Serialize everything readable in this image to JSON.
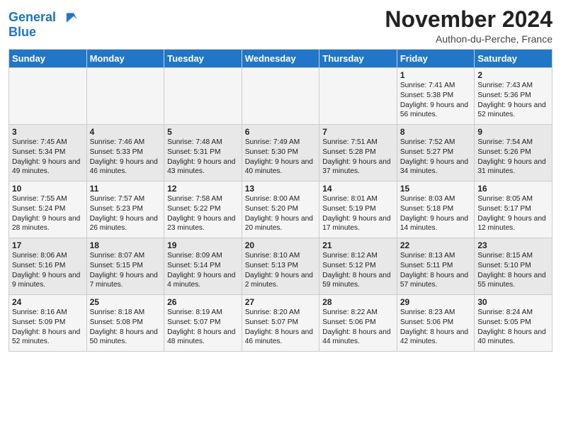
{
  "logo": {
    "line1": "General",
    "line2": "Blue"
  },
  "title": "November 2024",
  "location": "Authon-du-Perche, France",
  "days_of_week": [
    "Sunday",
    "Monday",
    "Tuesday",
    "Wednesday",
    "Thursday",
    "Friday",
    "Saturday"
  ],
  "weeks": [
    [
      {
        "day": "",
        "sunrise": "",
        "sunset": "",
        "daylight": ""
      },
      {
        "day": "",
        "sunrise": "",
        "sunset": "",
        "daylight": ""
      },
      {
        "day": "",
        "sunrise": "",
        "sunset": "",
        "daylight": ""
      },
      {
        "day": "",
        "sunrise": "",
        "sunset": "",
        "daylight": ""
      },
      {
        "day": "",
        "sunrise": "",
        "sunset": "",
        "daylight": ""
      },
      {
        "day": "1",
        "sunrise": "Sunrise: 7:41 AM",
        "sunset": "Sunset: 5:38 PM",
        "daylight": "Daylight: 9 hours and 56 minutes."
      },
      {
        "day": "2",
        "sunrise": "Sunrise: 7:43 AM",
        "sunset": "Sunset: 5:36 PM",
        "daylight": "Daylight: 9 hours and 52 minutes."
      }
    ],
    [
      {
        "day": "3",
        "sunrise": "Sunrise: 7:45 AM",
        "sunset": "Sunset: 5:34 PM",
        "daylight": "Daylight: 9 hours and 49 minutes."
      },
      {
        "day": "4",
        "sunrise": "Sunrise: 7:46 AM",
        "sunset": "Sunset: 5:33 PM",
        "daylight": "Daylight: 9 hours and 46 minutes."
      },
      {
        "day": "5",
        "sunrise": "Sunrise: 7:48 AM",
        "sunset": "Sunset: 5:31 PM",
        "daylight": "Daylight: 9 hours and 43 minutes."
      },
      {
        "day": "6",
        "sunrise": "Sunrise: 7:49 AM",
        "sunset": "Sunset: 5:30 PM",
        "daylight": "Daylight: 9 hours and 40 minutes."
      },
      {
        "day": "7",
        "sunrise": "Sunrise: 7:51 AM",
        "sunset": "Sunset: 5:28 PM",
        "daylight": "Daylight: 9 hours and 37 minutes."
      },
      {
        "day": "8",
        "sunrise": "Sunrise: 7:52 AM",
        "sunset": "Sunset: 5:27 PM",
        "daylight": "Daylight: 9 hours and 34 minutes."
      },
      {
        "day": "9",
        "sunrise": "Sunrise: 7:54 AM",
        "sunset": "Sunset: 5:26 PM",
        "daylight": "Daylight: 9 hours and 31 minutes."
      }
    ],
    [
      {
        "day": "10",
        "sunrise": "Sunrise: 7:55 AM",
        "sunset": "Sunset: 5:24 PM",
        "daylight": "Daylight: 9 hours and 28 minutes."
      },
      {
        "day": "11",
        "sunrise": "Sunrise: 7:57 AM",
        "sunset": "Sunset: 5:23 PM",
        "daylight": "Daylight: 9 hours and 26 minutes."
      },
      {
        "day": "12",
        "sunrise": "Sunrise: 7:58 AM",
        "sunset": "Sunset: 5:22 PM",
        "daylight": "Daylight: 9 hours and 23 minutes."
      },
      {
        "day": "13",
        "sunrise": "Sunrise: 8:00 AM",
        "sunset": "Sunset: 5:20 PM",
        "daylight": "Daylight: 9 hours and 20 minutes."
      },
      {
        "day": "14",
        "sunrise": "Sunrise: 8:01 AM",
        "sunset": "Sunset: 5:19 PM",
        "daylight": "Daylight: 9 hours and 17 minutes."
      },
      {
        "day": "15",
        "sunrise": "Sunrise: 8:03 AM",
        "sunset": "Sunset: 5:18 PM",
        "daylight": "Daylight: 9 hours and 14 minutes."
      },
      {
        "day": "16",
        "sunrise": "Sunrise: 8:05 AM",
        "sunset": "Sunset: 5:17 PM",
        "daylight": "Daylight: 9 hours and 12 minutes."
      }
    ],
    [
      {
        "day": "17",
        "sunrise": "Sunrise: 8:06 AM",
        "sunset": "Sunset: 5:16 PM",
        "daylight": "Daylight: 9 hours and 9 minutes."
      },
      {
        "day": "18",
        "sunrise": "Sunrise: 8:07 AM",
        "sunset": "Sunset: 5:15 PM",
        "daylight": "Daylight: 9 hours and 7 minutes."
      },
      {
        "day": "19",
        "sunrise": "Sunrise: 8:09 AM",
        "sunset": "Sunset: 5:14 PM",
        "daylight": "Daylight: 9 hours and 4 minutes."
      },
      {
        "day": "20",
        "sunrise": "Sunrise: 8:10 AM",
        "sunset": "Sunset: 5:13 PM",
        "daylight": "Daylight: 9 hours and 2 minutes."
      },
      {
        "day": "21",
        "sunrise": "Sunrise: 8:12 AM",
        "sunset": "Sunset: 5:12 PM",
        "daylight": "Daylight: 8 hours and 59 minutes."
      },
      {
        "day": "22",
        "sunrise": "Sunrise: 8:13 AM",
        "sunset": "Sunset: 5:11 PM",
        "daylight": "Daylight: 8 hours and 57 minutes."
      },
      {
        "day": "23",
        "sunrise": "Sunrise: 8:15 AM",
        "sunset": "Sunset: 5:10 PM",
        "daylight": "Daylight: 8 hours and 55 minutes."
      }
    ],
    [
      {
        "day": "24",
        "sunrise": "Sunrise: 8:16 AM",
        "sunset": "Sunset: 5:09 PM",
        "daylight": "Daylight: 8 hours and 52 minutes."
      },
      {
        "day": "25",
        "sunrise": "Sunrise: 8:18 AM",
        "sunset": "Sunset: 5:08 PM",
        "daylight": "Daylight: 8 hours and 50 minutes."
      },
      {
        "day": "26",
        "sunrise": "Sunrise: 8:19 AM",
        "sunset": "Sunset: 5:07 PM",
        "daylight": "Daylight: 8 hours and 48 minutes."
      },
      {
        "day": "27",
        "sunrise": "Sunrise: 8:20 AM",
        "sunset": "Sunset: 5:07 PM",
        "daylight": "Daylight: 8 hours and 46 minutes."
      },
      {
        "day": "28",
        "sunrise": "Sunrise: 8:22 AM",
        "sunset": "Sunset: 5:06 PM",
        "daylight": "Daylight: 8 hours and 44 minutes."
      },
      {
        "day": "29",
        "sunrise": "Sunrise: 8:23 AM",
        "sunset": "Sunset: 5:06 PM",
        "daylight": "Daylight: 8 hours and 42 minutes."
      },
      {
        "day": "30",
        "sunrise": "Sunrise: 8:24 AM",
        "sunset": "Sunset: 5:05 PM",
        "daylight": "Daylight: 8 hours and 40 minutes."
      }
    ]
  ]
}
